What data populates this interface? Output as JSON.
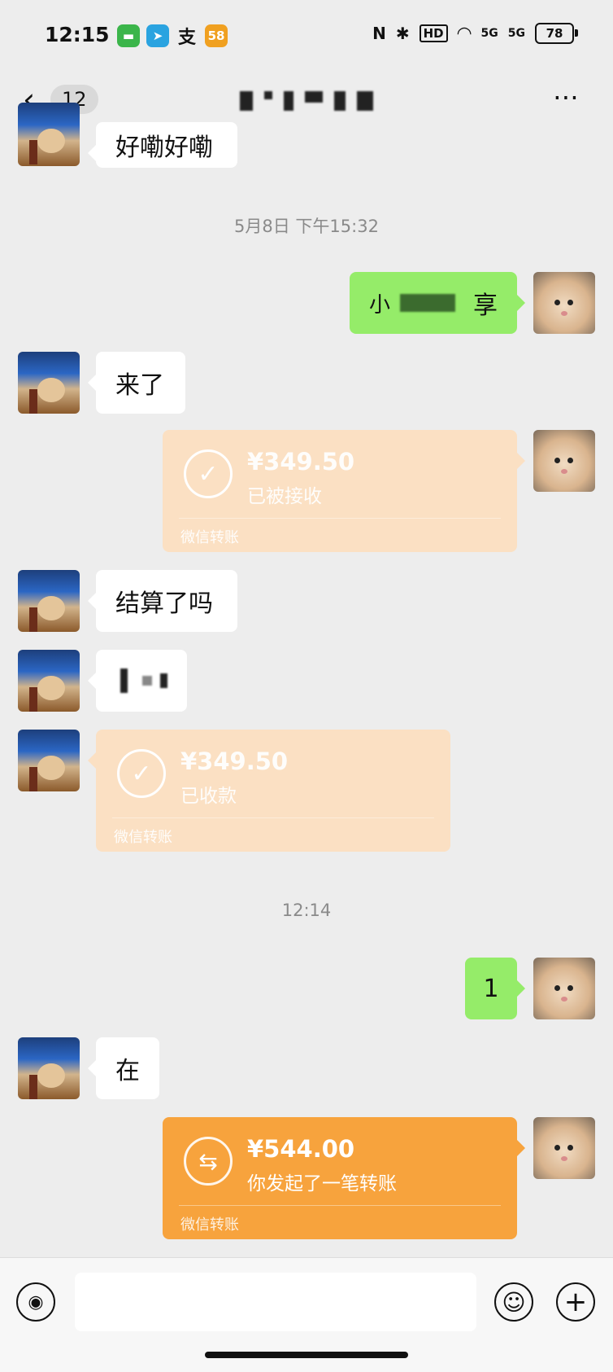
{
  "status_bar": {
    "time": "12:15",
    "apps": [
      {
        "icon": "messages-app-icon",
        "color": "#3bb54a",
        "glyph": "▬"
      },
      {
        "icon": "telegram-app-icon",
        "color": "#2aa3e0",
        "glyph": "➤"
      },
      {
        "icon": "alipay-app-icon",
        "color": "#111111",
        "glyph": "支"
      },
      {
        "icon": "58-app-icon",
        "color": "#f0a020",
        "glyph": "58"
      }
    ],
    "battery": "78",
    "indicators": [
      "N",
      "✱",
      "HD",
      "WiFi",
      "5G",
      "5G"
    ]
  },
  "nav": {
    "back_icon": "‹",
    "unread_count": "12",
    "more_icon": "⋯"
  },
  "messages": {
    "partial_top": "好嘞好嘞",
    "ts1": "5月8日 下午15:32",
    "out1_prefix": "小",
    "out1_suffix": "享",
    "in1": "来了",
    "xfer1": {
      "amount": "¥349.50",
      "status": "已被接收",
      "foot": "微信转账"
    },
    "in2": "结算了吗",
    "xfer2": {
      "amount": "¥349.50",
      "status": "已收款",
      "foot": "微信转账"
    },
    "ts2": "12:14",
    "out2": "1",
    "in4": "在",
    "xfer3": {
      "amount": "¥544.00",
      "status": "你发起了一笔转账",
      "foot": "微信转账"
    }
  },
  "colors": {
    "sent_bubble": "#95ec69",
    "received_bubble": "#ffffff",
    "transfer_active": "#f7a33d",
    "transfer_done": "#fbe0c3",
    "background": "#ededed"
  },
  "input_bar": {
    "voice_icon": "◉",
    "emoji_icon": "☺",
    "plus_icon": "+"
  }
}
